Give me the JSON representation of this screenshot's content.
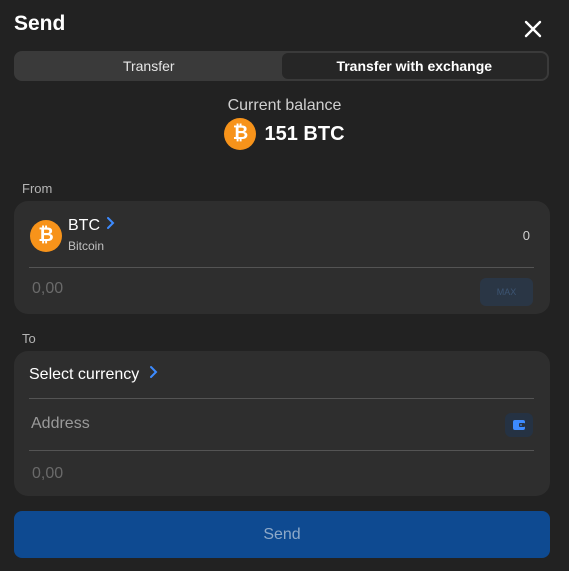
{
  "dialog": {
    "title": "Send"
  },
  "tabs": [
    {
      "label": "Transfer",
      "active": false
    },
    {
      "label": "Transfer with exchange",
      "active": true
    }
  ],
  "balance": {
    "label": "Current balance",
    "amount": "151 BTC",
    "coin_symbol": "₿"
  },
  "from": {
    "section_label": "From",
    "coin": {
      "ticker": "BTC",
      "name": "Bitcoin",
      "symbol": "₿",
      "available": "0"
    },
    "amount_placeholder": "0,00",
    "max_label": "MAX"
  },
  "to": {
    "section_label": "To",
    "select_label": "Select currency",
    "address_placeholder": "Address",
    "amount_placeholder": "0,00"
  },
  "actions": {
    "send_label": "Send"
  },
  "colors": {
    "accent": "#3d8bff",
    "btc": "#f7931a",
    "send_button": "#0e4a91"
  }
}
